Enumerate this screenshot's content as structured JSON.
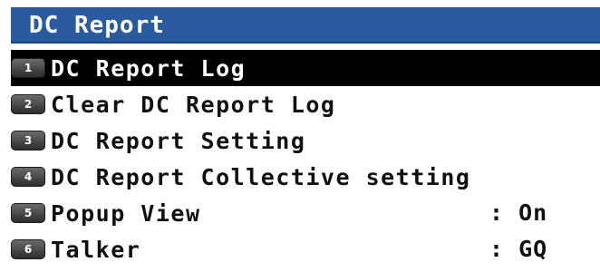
{
  "title": "DC Report",
  "menu": {
    "items": [
      {
        "key": "1",
        "label": "DC Report Log",
        "value": null
      },
      {
        "key": "2",
        "label": "Clear DC Report Log",
        "value": null
      },
      {
        "key": "3",
        "label": "DC Report Setting",
        "value": null
      },
      {
        "key": "4",
        "label": "DC Report Collective setting",
        "value": null
      },
      {
        "key": "5",
        "label": "Popup View",
        "value": ": On"
      },
      {
        "key": "6",
        "label": "Talker",
        "value": ": GQ"
      }
    ],
    "selected_index": 0
  },
  "colors": {
    "title_bar": "#2a5b9f",
    "selection": "#000000",
    "text": "#111111",
    "background": "#ffffff"
  }
}
